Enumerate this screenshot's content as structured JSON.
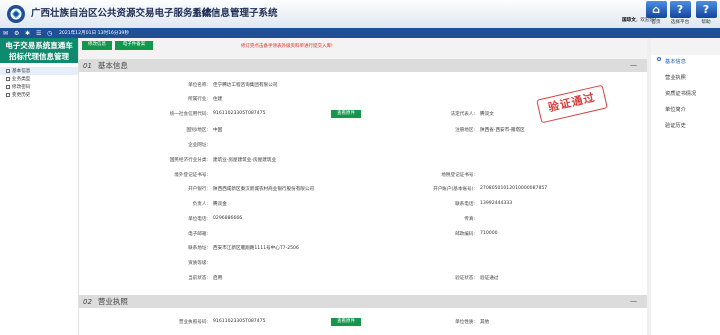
{
  "header": {
    "title": "广西壮族自治区公共资源交易电子服务系统",
    "subtitle": "主体信息管理子系统",
    "greeting_user": "国琼文",
    "greeting_suffix": "，欢迎您！",
    "buttons": [
      {
        "icon": "home-icon",
        "label": "首页"
      },
      {
        "icon": "question-icon",
        "label": "选择平台"
      },
      {
        "icon": "question-icon",
        "label": "帮助"
      }
    ]
  },
  "statusbar": {
    "datetime": "2021年12月01日 13时16分39秒"
  },
  "sidebar": {
    "title_line1": "电子交易系统直通车",
    "title_line2": "招标代理信息管理",
    "items": [
      {
        "label": "基本信息"
      },
      {
        "label": "业务类型"
      },
      {
        "label": "修改密码"
      },
      {
        "label": "变更历史"
      }
    ]
  },
  "toolbar": {
    "modify_label": "修改信息",
    "submit_label": "电子件备案",
    "notice": "修订完点击备手领表外级资料单进行提交入库!"
  },
  "section1": {
    "num": "01",
    "title": "基本信息",
    "fields": {
      "unit_name": {
        "label": "单位名称:",
        "value": "佳宁腾达工程咨询集团有限公司"
      },
      "industry": {
        "label": "所属行业:",
        "value": "住建"
      },
      "credit_code": {
        "label": "统一社会信用代码:",
        "value": "91611023305T087475"
      },
      "legal_rep": {
        "label": "法定代表人:",
        "value": "腾双文"
      },
      "country": {
        "label": "国别/地区:",
        "value": "中国"
      },
      "reg_area": {
        "label": "注册地区:",
        "value": "陕西省-西安市-雁塔区"
      },
      "website": {
        "label": "企业网址:",
        "value": ""
      },
      "national_industry": {
        "label": "国民经济行业分类:",
        "value": "建筑业-房屋建筑业-房屋建筑业"
      },
      "foreign_reg": {
        "label": "境外登记证书号:",
        "value": ""
      },
      "local_reg": {
        "label": "地税登记证书号:",
        "value": ""
      },
      "bank": {
        "label": "开户银行:",
        "value": "陕西西咸新区秦汉新城农村商业银行股份有限公司"
      },
      "bank_account": {
        "label": "开户账户(基本账号):",
        "value": "27080501012010000087857"
      },
      "contact": {
        "label": "负责人:",
        "value": "腾双金"
      },
      "phone": {
        "label": "联系电话:",
        "value": "13992444333"
      },
      "unit_phone": {
        "label": "单位电话:",
        "value": "0296886666"
      },
      "fax": {
        "label": "传真:",
        "value": ""
      },
      "email": {
        "label": "电子邮箱:",
        "value": ""
      },
      "postcode": {
        "label": "邮政编码:",
        "value": "710000"
      },
      "address": {
        "label": "联系地址:",
        "value": "西安市江新区雁翔路1111号中心T7-2506"
      },
      "remark": {
        "label": "资质等级:",
        "value": ""
      },
      "status": {
        "label": "当前状态:",
        "value": "启用"
      },
      "verify_status": {
        "label": "验证状态:",
        "value": "验证通过"
      }
    },
    "view_label": "查看原件",
    "stamp": "验证通过"
  },
  "section2": {
    "num": "02",
    "title": "营业执照",
    "credit_code": {
      "label": "营业执照号码:",
      "value": "91611023305T087475"
    },
    "unit_nature": {
      "label": "单位性质:",
      "value": "其他"
    },
    "view_label": "查看原件"
  },
  "right_nav": [
    {
      "label": "基本信息"
    },
    {
      "label": "营业执照"
    },
    {
      "label": "资质证书情况"
    },
    {
      "label": "单位简介"
    },
    {
      "label": "验证历史"
    }
  ],
  "colors": {
    "header_blue": "#1f4f97",
    "sidebar_title": "#0f8a6e",
    "button_green": "#14974c",
    "notice_red": "#e42626",
    "stamp_red": "#d73d3d"
  }
}
